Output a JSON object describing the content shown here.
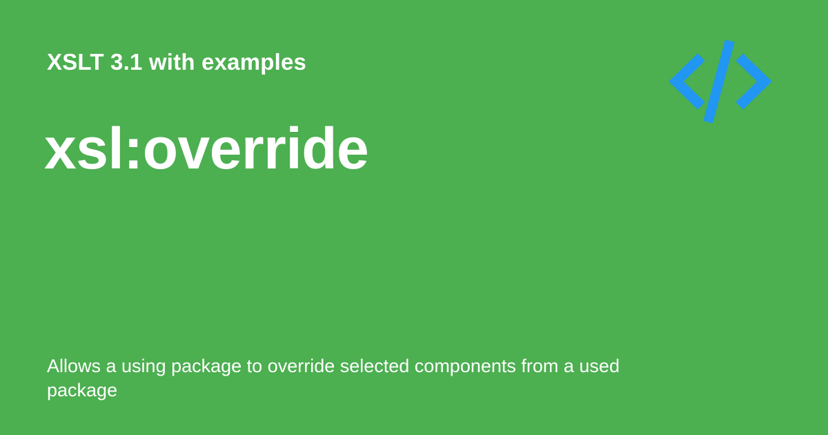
{
  "card": {
    "series_title": "XSLT 3.1 with examples",
    "page_title": "xsl:override",
    "description": "Allows a using package to override selected components from a used package",
    "logo_icon": "code-brackets-icon"
  },
  "colors": {
    "background": "#4caf50",
    "text": "#ffffff",
    "logo": "#2196f3"
  }
}
